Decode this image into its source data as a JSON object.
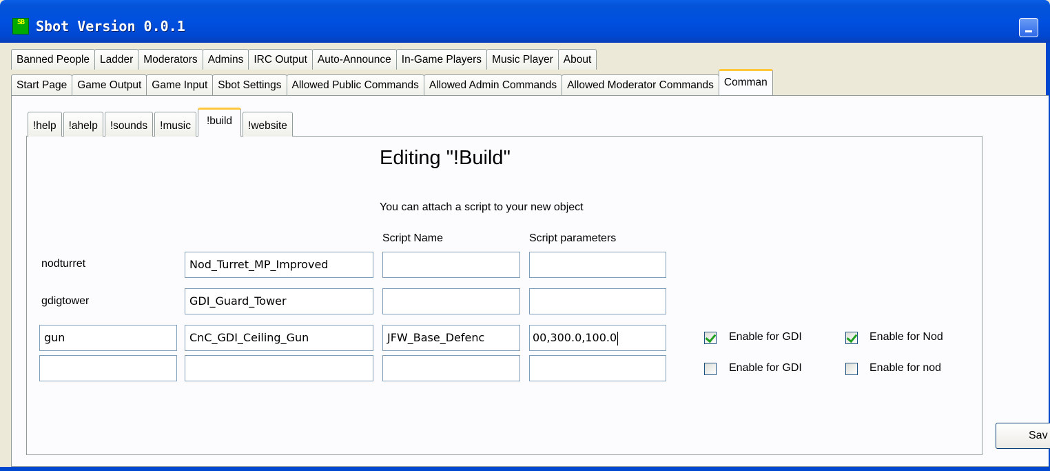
{
  "window": {
    "title": "Sbot Version 0.0.1",
    "icon": "SB"
  },
  "outer_tabs_row1": [
    "Banned People",
    "Ladder",
    "Moderators",
    "Admins",
    "IRC Output",
    "Auto-Announce",
    "In-Game Players",
    "Music Player",
    "About"
  ],
  "outer_tabs_row2": [
    "Start Page",
    "Game Output",
    "Game Input",
    "Sbot Settings",
    "Allowed Public Commands",
    "Allowed Admin Commands",
    "Allowed Moderator Commands",
    "Comman"
  ],
  "inner_tabs": [
    "!help",
    "!ahelp",
    "!sounds",
    "!music",
    "!build",
    "!website"
  ],
  "editor": {
    "heading": "Editing \"!Build\"",
    "note": "You can attach a script to your new object",
    "col_script_name": "Script Name",
    "col_script_params": "Script parameters",
    "rows": [
      {
        "label": "nodturret",
        "object": "Nod_Turret_MP_Improved",
        "script": "",
        "params": ""
      },
      {
        "label": "gdigtower",
        "object": "GDI_Guard_Tower",
        "script": "",
        "params": ""
      },
      {
        "name": "gun",
        "object": "CnC_GDI_Ceiling_Gun",
        "script": "JFW_Base_Defenc",
        "params": "00,300.0,100.0",
        "gdi": true,
        "gdi_label": "Enable for GDI",
        "nod": true,
        "nod_label": "Enable for Nod"
      },
      {
        "name": "",
        "object": "",
        "script": "",
        "params": "",
        "gdi": false,
        "gdi_label": "Enable for GDI",
        "nod": false,
        "nod_label": "Enable for nod"
      }
    ]
  },
  "save_label": "Sav"
}
